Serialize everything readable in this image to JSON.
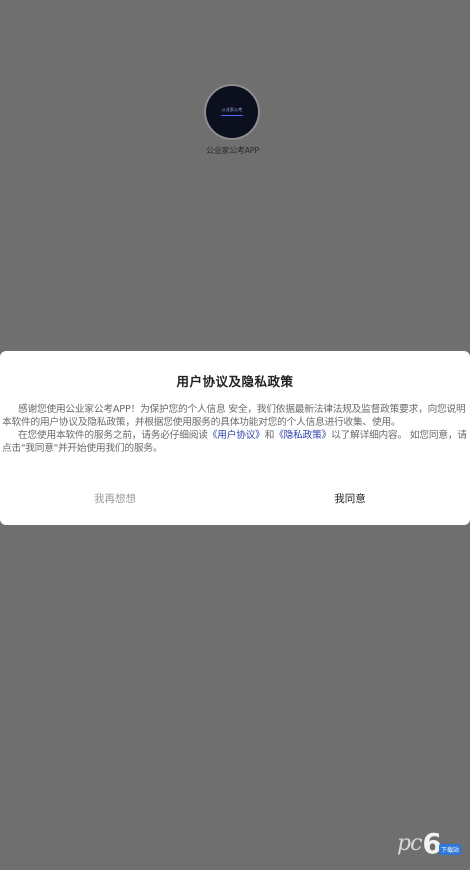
{
  "app": {
    "logo_text": "公业家公考",
    "name": "公业家公考APP"
  },
  "dialog": {
    "title": "用户协议及隐私政策",
    "paragraph1": "感谢您使用公业家公考APP！为保护您的个人信息 安全，我们依据最新法律法规及监督政策要求，向您说明本软件的用户协议及隐私政策，并根据您使用服务的具体功能对您的个人信息进行收集、使用。",
    "paragraph2_before": "在您使用本软件的服务之前，请务必仔细阅读",
    "user_agreement_link": "《用户协议》",
    "paragraph2_and": "和",
    "privacy_policy_link": "《隐私政策》",
    "paragraph2_after": "以了解详细内容。 如您同意，请点击\"我同意\"并开始使用我们的服务。",
    "decline_label": "我再想想",
    "accept_label": "我同意"
  },
  "watermark": {
    "pc": "pc",
    "six": "6",
    "badge": "下载站"
  },
  "colors": {
    "backdrop": "#6f6f6f",
    "dialog_bg": "#ffffff",
    "link": "#2b3fa8",
    "logo_bg": "#0b0f1e"
  }
}
